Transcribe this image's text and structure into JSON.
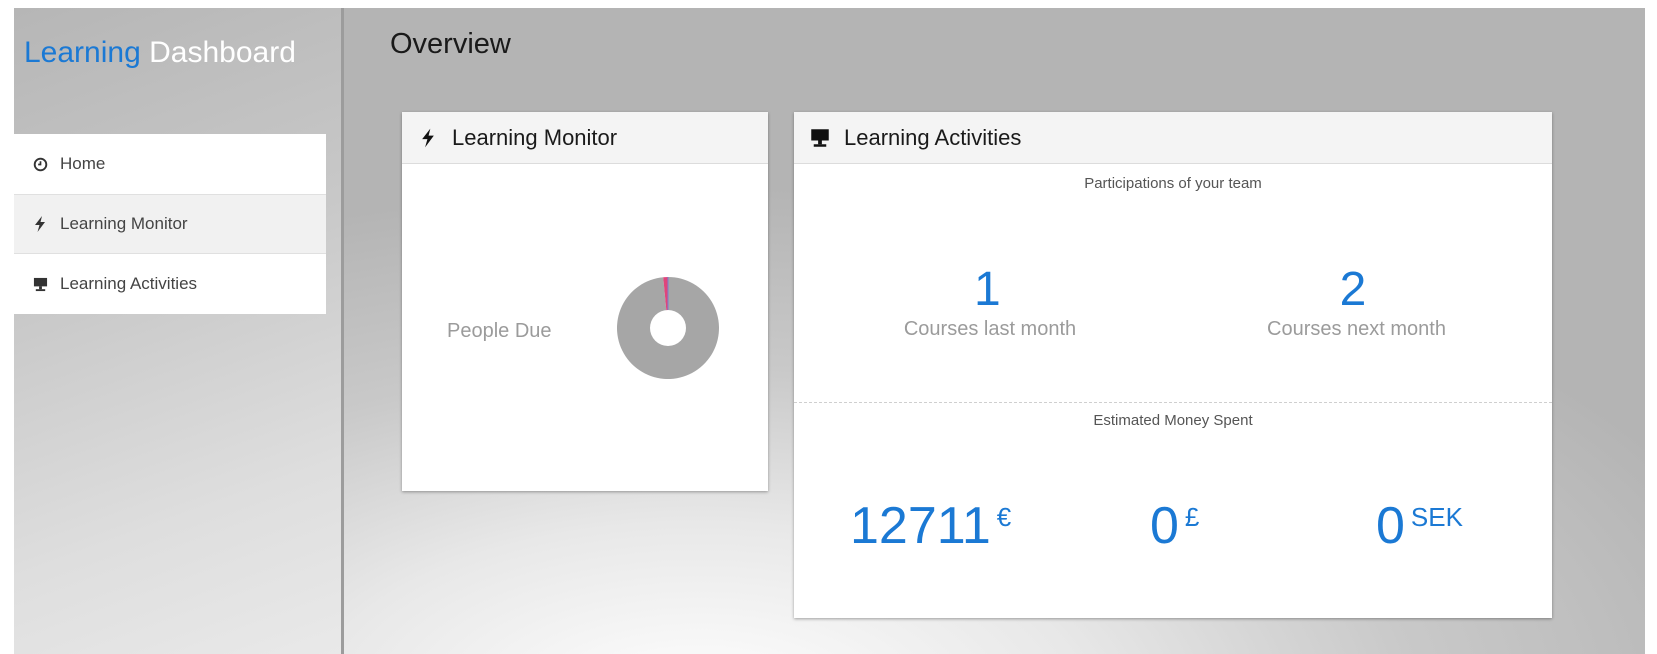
{
  "brand": {
    "part1": "Learning",
    "part2": "Dashboard"
  },
  "sidebar": {
    "items": [
      {
        "label": "Home",
        "icon": "clock-icon"
      },
      {
        "label": "Learning Monitor",
        "icon": "bolt-icon"
      },
      {
        "label": "Learning Activities",
        "icon": "monitor-icon"
      }
    ]
  },
  "main": {
    "title": "Overview",
    "monitor_card": {
      "title": "Learning Monitor",
      "label": "People Due",
      "donut": {
        "segments": [
          {
            "value": 0.985,
            "color": "#a6a6a6"
          },
          {
            "value": 0.015,
            "color": "#e0457b"
          }
        ],
        "edge_color": "#7a7fd0"
      }
    },
    "activities_card": {
      "title": "Learning Activities",
      "participations": {
        "label": "Participations of your team",
        "last_month": {
          "value": "1",
          "label": "Courses last month"
        },
        "next_month": {
          "value": "2",
          "label": "Courses next month"
        }
      },
      "money": {
        "label": "Estimated Money Spent",
        "amounts": [
          {
            "value": "12711",
            "currency": "€"
          },
          {
            "value": "0",
            "currency": "£"
          },
          {
            "value": "0",
            "currency": "SEK"
          }
        ]
      }
    }
  },
  "colors": {
    "accent": "#1b79d4",
    "brand_secondary": "#ffffff",
    "muted_text": "#9b9b9b"
  }
}
